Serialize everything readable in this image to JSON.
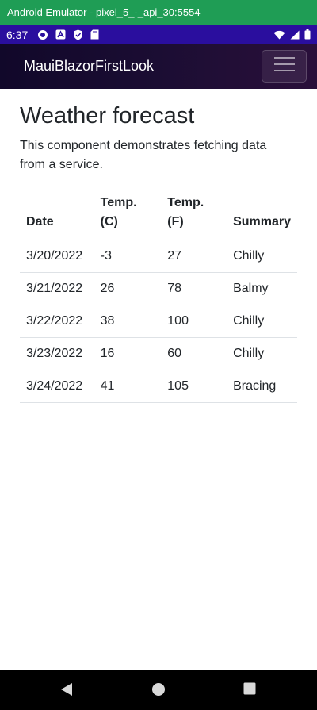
{
  "emulator": {
    "title": "Android Emulator - pixel_5_-_api_30:5554"
  },
  "status_bar": {
    "time": "6:37",
    "left_icons": [
      "gear-icon",
      "a-text-icon",
      "shield-icon",
      "sd-card-icon"
    ],
    "right_icons": [
      "wifi-icon",
      "signal-icon",
      "battery-icon"
    ]
  },
  "app_bar": {
    "brand": "MauiBlazorFirstLook",
    "menu_icon": "hamburger-icon"
  },
  "page": {
    "title": "Weather forecast",
    "description": "This component demonstrates fetching data from a service.",
    "table": {
      "headers": {
        "date": "Date",
        "temp_c": "Temp. (C)",
        "temp_f": "Temp. (F)",
        "summary": "Summary"
      },
      "rows": [
        {
          "date": "3/20/2022",
          "temp_c": "-3",
          "temp_f": "27",
          "summary": "Chilly"
        },
        {
          "date": "3/21/2022",
          "temp_c": "26",
          "temp_f": "78",
          "summary": "Balmy"
        },
        {
          "date": "3/22/2022",
          "temp_c": "38",
          "temp_f": "100",
          "summary": "Chilly"
        },
        {
          "date": "3/23/2022",
          "temp_c": "16",
          "temp_f": "60",
          "summary": "Chilly"
        },
        {
          "date": "3/24/2022",
          "temp_c": "41",
          "temp_f": "105",
          "summary": "Bracing"
        }
      ]
    }
  },
  "nav_bar": {
    "buttons": [
      "back-icon",
      "home-icon",
      "recents-icon"
    ]
  },
  "colors": {
    "emulator_bar": "#1f9d55",
    "status_bar": "#2a0e9e",
    "app_bar_start": "#11082a",
    "app_bar_end": "#2a0f3a",
    "text": "#212529"
  }
}
